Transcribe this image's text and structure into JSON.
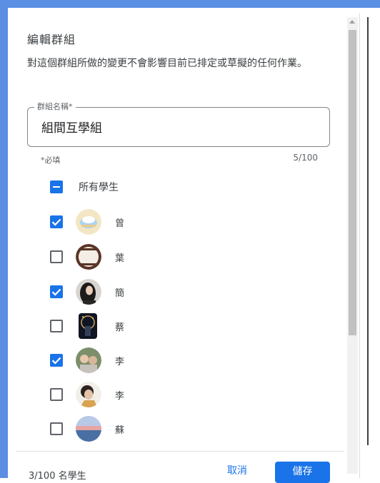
{
  "dialog": {
    "title": "編輯群組",
    "description": "對這個群組所做的變更不會影響目前已排定或草擬的任何作業。"
  },
  "group_name_field": {
    "label": "群組名稱*",
    "value": "組間互學組",
    "helper": "*必填",
    "counter": "5/100"
  },
  "select_all": {
    "label": "所有學生",
    "state": "indeterminate"
  },
  "students": [
    {
      "name": "曾",
      "checked": true,
      "avatar": "avatar-cloud-icon"
    },
    {
      "name": "葉",
      "checked": false,
      "avatar": "avatar-frame-icon"
    },
    {
      "name": "簡",
      "checked": true,
      "avatar": "avatar-portrait-icon"
    },
    {
      "name": "蔡",
      "checked": false,
      "avatar": "avatar-night-icon"
    },
    {
      "name": "李",
      "checked": true,
      "avatar": "avatar-outdoor-icon"
    },
    {
      "name": "李",
      "checked": false,
      "avatar": "avatar-selfie-icon"
    },
    {
      "name": "蘇",
      "checked": false,
      "avatar": "avatar-sunset-icon"
    }
  ],
  "footer": {
    "count_label": "3/100 名學生",
    "cancel_label": "取消",
    "save_label": "儲存"
  },
  "colors": {
    "accent": "#1a73e8",
    "frame": "#5b8fe3"
  }
}
